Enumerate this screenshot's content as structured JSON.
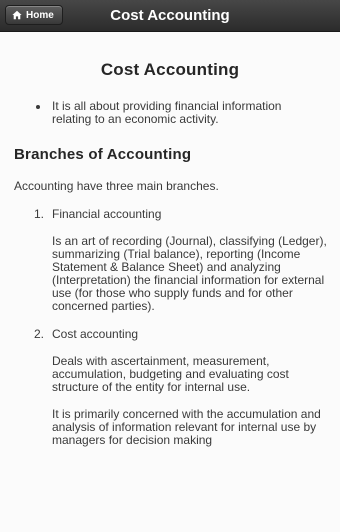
{
  "header": {
    "home_label": "Home",
    "title": "Cost Accounting"
  },
  "main": {
    "page_title": "Cost Accounting",
    "intro_bullets": [
      "It is all about providing financial information relating to an economic activity."
    ],
    "section_heading": "Branches of Accounting",
    "section_intro": "Accounting have three main branches.",
    "branches": [
      {
        "number": "1.",
        "title": "Financial accounting",
        "paragraphs": [
          "Is an art of recording (Journal), classifying (Ledger), summarizing (Trial balance), reporting (Income Statement & Balance Sheet) and analyzing (Interpretation) the financial information for external use (for those who supply funds and for other concerned parties)."
        ]
      },
      {
        "number": "2.",
        "title": "Cost accounting",
        "paragraphs": [
          "Deals with ascertainment, measurement, accumulation, budgeting and evaluating cost structure of the entity for internal use.",
          "It is primarily concerned with the accumulation and analysis of information relevant for internal use by managers for decision making"
        ]
      }
    ]
  }
}
